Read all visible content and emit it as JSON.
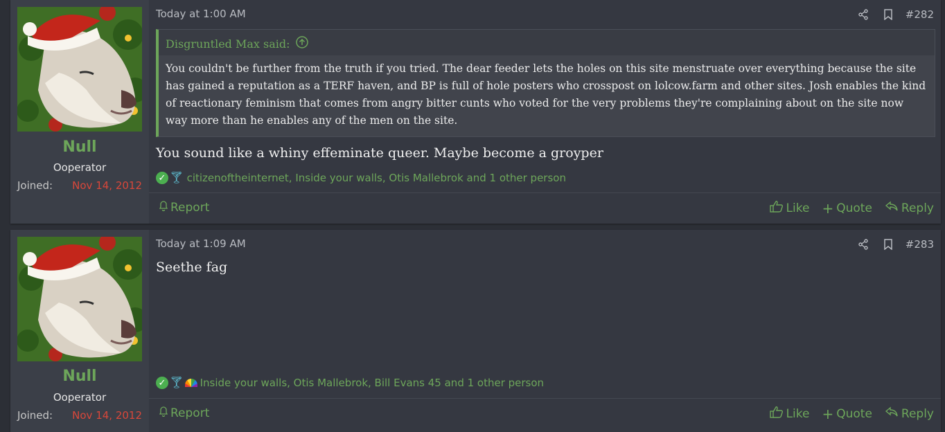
{
  "posts": [
    {
      "user": {
        "name": "Null",
        "title": "Ooperator",
        "joined_label": "Joined:",
        "joined_date": "Nov 14, 2012"
      },
      "date": "Today at 1:00 AM",
      "number": "#282",
      "quote": {
        "author_line": "Disgruntled Max said:",
        "text": "You couldn't be further from the truth if you tried. The dear feeder lets the holes on this site menstruate over everything because the site has gained a reputation as a TERF haven, and BP is full of hole posters who crosspost on lolcow.farm and other sites. Josh enables the kind of reactionary feminism that comes from angry bitter cunts who voted for the very problems they're complaining about on the site now way more than he enables any of the men on the site."
      },
      "message": "You sound like a whiny effeminate queer. Maybe become a groyper",
      "reactions": "citizenoftheinternet, Inside your walls, Otis Mallebrok and 1 other person",
      "report_label": "Report",
      "like_label": "Like",
      "quote_label": "Quote",
      "reply_label": "Reply"
    },
    {
      "user": {
        "name": "Null",
        "title": "Ooperator",
        "joined_label": "Joined:",
        "joined_date": "Nov 14, 2012"
      },
      "date": "Today at 1:09 AM",
      "number": "#283",
      "message": "Seethe fag",
      "reactions": "Inside your walls, Otis Mallebrok, Bill Evans 45 and 1 other person",
      "report_label": "Report",
      "like_label": "Like",
      "quote_label": "Quote",
      "reply_label": "Reply"
    }
  ],
  "icons": {
    "share": "share-icon",
    "bookmark": "bookmark-icon",
    "bell": "bell-icon",
    "like": "thumbs-up-icon",
    "quote": "plus-icon",
    "reply": "reply-arrow-icon",
    "expand": "arrow-up-circle-icon"
  },
  "colors": {
    "accent": "#6da65a",
    "joined": "#d9473a",
    "background": "#2c2f36",
    "post_bg": "#353841"
  }
}
